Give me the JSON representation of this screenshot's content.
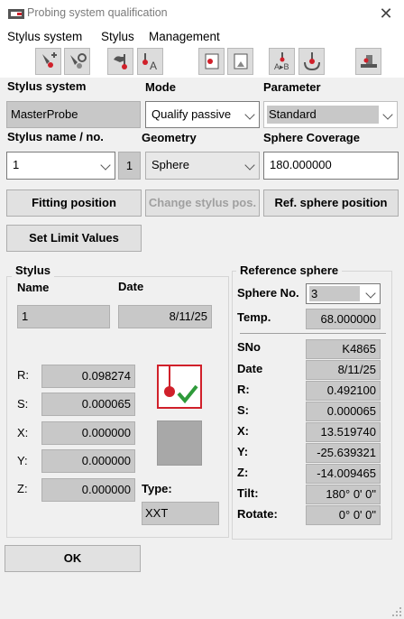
{
  "window": {
    "title": "Probing system qualification",
    "close_glyph": "✕"
  },
  "menu": {
    "items": [
      "Stylus system",
      "Stylus",
      "Management"
    ]
  },
  "toolbar": {
    "icons": [
      "stylus-add-icon",
      "stylus-edit-icon",
      "probe-hand-icon",
      "probe-a-icon",
      "page-red-icon",
      "page-icon",
      "ab-icon",
      "probe-target-icon",
      "machine-icon"
    ]
  },
  "top": {
    "stylus_system_label": "Stylus system",
    "mode_label": "Mode",
    "parameter_label": "Parameter",
    "stylus_system_value": "MasterProbe",
    "mode_value": "Qualify passive",
    "parameter_value": "Standard",
    "stylus_name_label": "Stylus name / no.",
    "geometry_label": "Geometry",
    "sphere_coverage_label": "Sphere Coverage",
    "stylus_name_value": "1",
    "stylus_no_value": "1",
    "geometry_value": "Sphere",
    "sphere_coverage_value": "180.000000"
  },
  "buttons": {
    "fitting_position": "Fitting position",
    "change_stylus_pos": "Change stylus pos.",
    "ref_sphere_position": "Ref. sphere position",
    "set_limit_values": "Set Limit Values",
    "ok": "OK"
  },
  "stylus": {
    "group_title": "Stylus",
    "name_label": "Name",
    "date_label": "Date",
    "name_value": "1",
    "date_value": "8/11/25",
    "r_label": "R:",
    "r_value": "0.098274",
    "s_label": "S:",
    "s_value": "0.000065",
    "x_label": "X:",
    "x_value": "0.000000",
    "y_label": "Y:",
    "y_value": "0.000000",
    "z_label": "Z:",
    "z_value": "0.000000",
    "type_label": "Type:",
    "type_value": "XXT"
  },
  "reference_sphere": {
    "group_title": "Reference sphere",
    "sphere_no_label": "Sphere No.",
    "sphere_no_value": "3",
    "temp_label": "Temp.",
    "temp_value": "68.000000",
    "sno_label": "SNo",
    "sno_value": "K4865",
    "date_label": "Date",
    "date_value": "8/11/25",
    "r_label": "R:",
    "r_value": "0.492100",
    "s_label": "S:",
    "s_value": "0.000065",
    "x_label": "X:",
    "x_value": "13.519740",
    "y_label": "Y:",
    "y_value": "-25.639321",
    "z_label": "Z:",
    "z_value": "-14.009465",
    "tilt_label": "Tilt:",
    "tilt_value": "180° 0' 0\"",
    "rotate_label": "Rotate:",
    "rotate_value": "0° 0' 0\""
  },
  "colors": {
    "accent_red": "#d0202a",
    "check_green": "#2e9a3a",
    "panel": "#f0f0f0",
    "field_gray": "#c8c8c8"
  }
}
